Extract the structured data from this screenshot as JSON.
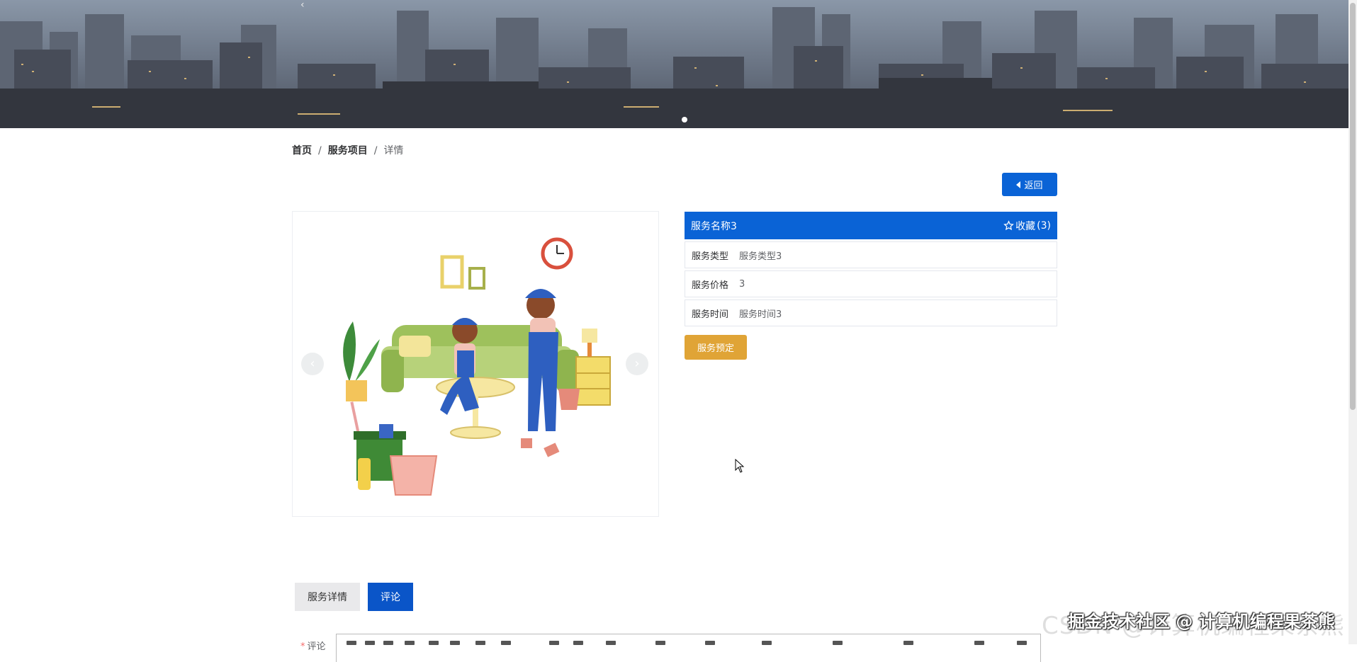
{
  "banner": {
    "arrow_icon": "chevron-left-icon",
    "active_slide_indicator": 1
  },
  "breadcrumb": {
    "home": "首页",
    "section": "服务项目",
    "current": "详情",
    "separator": "/"
  },
  "back_button": {
    "label": "返回",
    "icon": "caret-left-icon"
  },
  "service": {
    "name": "服务名称3",
    "favorite_label": "收藏",
    "favorite_count": "3",
    "favorite_icon": "star-outline-icon",
    "rows": [
      {
        "label": "服务类型",
        "value": "服务类型3"
      },
      {
        "label": "服务价格",
        "value": "3"
      },
      {
        "label": "服务时间",
        "value": "服务时间3"
      }
    ],
    "order_button": "服务预定"
  },
  "gallery": {
    "prev_icon": "chevron-left-icon",
    "next_icon": "chevron-right-icon"
  },
  "tabs": [
    {
      "label": "服务详情",
      "active": false
    },
    {
      "label": "评论",
      "active": true
    }
  ],
  "comment": {
    "required_mark": "*",
    "label": "评论"
  },
  "watermark": {
    "ghost": "CSDN @计算机编程果茶熊",
    "text": "掘金技术社区 @ 计算机编程果茶熊"
  },
  "colors": {
    "primary": "#0a63d6",
    "accent_orange": "#e0a436",
    "tab_active": "#0a55c8"
  }
}
